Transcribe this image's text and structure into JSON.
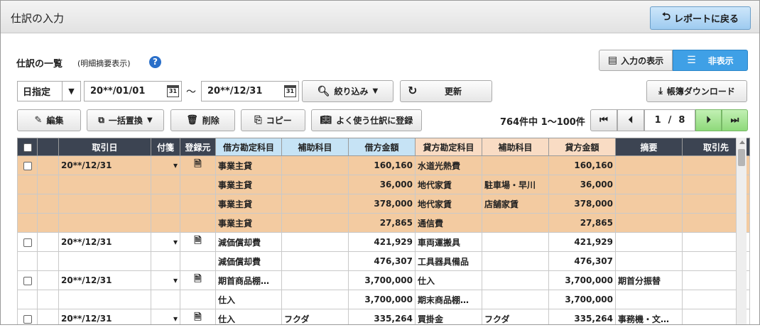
{
  "header": {
    "title": "仕訳の入力",
    "back_button": "レポートに戻る"
  },
  "list": {
    "title": "仕訳の一覧",
    "subtitle": "(明細摘要表示)",
    "help": "?"
  },
  "view_toggle": {
    "show": "入力の表示",
    "hide": "非表示"
  },
  "filters": {
    "period_type": "日指定",
    "date_from": "20**/01/01",
    "date_to": "20**/12/31",
    "tilde": "～",
    "calendar": "31",
    "narrow": "絞り込み",
    "refresh": "更新",
    "download": "帳簿ダウンロード"
  },
  "toolbar": {
    "edit": "編集",
    "bulk_replace": "一括置換",
    "delete": "削除",
    "copy": "コピー",
    "register_frequent": "よく使う仕訳に登録"
  },
  "pagination": {
    "info": "764件中 1～100件",
    "current": "1",
    "separator": "/",
    "total": "8"
  },
  "columns": [
    "取引日",
    "付箋",
    "登録元",
    "借方勘定科目",
    "補助科目",
    "借方金額",
    "貸方勘定科目",
    "補助科目",
    "貸方金額",
    "摘要",
    "取引先"
  ],
  "rows": [
    {
      "checkbox": true,
      "date": "20**/12/31",
      "tag": "▾",
      "src": true,
      "dr_acct": "事業主貸",
      "dr_sub": "",
      "dr_amt": "160,160",
      "cr_acct": "水道光熱費",
      "cr_sub": "",
      "cr_amt": "160,160",
      "memo": "",
      "partner": "",
      "hl": true
    },
    {
      "checkbox": false,
      "date": "",
      "tag": "",
      "src": false,
      "dr_acct": "事業主貸",
      "dr_sub": "",
      "dr_amt": "36,000",
      "cr_acct": "地代家賃",
      "cr_sub": "駐車場・早川",
      "cr_amt": "36,000",
      "memo": "",
      "partner": "",
      "hl": true
    },
    {
      "checkbox": false,
      "date": "",
      "tag": "",
      "src": false,
      "dr_acct": "事業主貸",
      "dr_sub": "",
      "dr_amt": "378,000",
      "cr_acct": "地代家賃",
      "cr_sub": "店舗家賃",
      "cr_amt": "378,000",
      "memo": "",
      "partner": "",
      "hl": true
    },
    {
      "checkbox": false,
      "date": "",
      "tag": "",
      "src": false,
      "dr_acct": "事業主貸",
      "dr_sub": "",
      "dr_amt": "27,865",
      "cr_acct": "通信費",
      "cr_sub": "",
      "cr_amt": "27,865",
      "memo": "",
      "partner": "",
      "hl": true
    },
    {
      "checkbox": true,
      "date": "20**/12/31",
      "tag": "▾",
      "src": true,
      "dr_acct": "減価償却費",
      "dr_sub": "",
      "dr_amt": "421,929",
      "cr_acct": "車両運搬具",
      "cr_sub": "",
      "cr_amt": "421,929",
      "memo": "",
      "partner": "",
      "hl": false
    },
    {
      "checkbox": false,
      "date": "",
      "tag": "",
      "src": false,
      "dr_acct": "減価償却費",
      "dr_sub": "",
      "dr_amt": "476,307",
      "cr_acct": "工具器具備品",
      "cr_sub": "",
      "cr_amt": "476,307",
      "memo": "",
      "partner": "",
      "hl": false
    },
    {
      "checkbox": true,
      "date": "20**/12/31",
      "tag": "▾",
      "src": true,
      "dr_acct": "期首商品棚…",
      "dr_sub": "",
      "dr_amt": "3,700,000",
      "cr_acct": "仕入",
      "cr_sub": "",
      "cr_amt": "3,700,000",
      "memo": "期首分振替",
      "partner": "",
      "hl": false
    },
    {
      "checkbox": false,
      "date": "",
      "tag": "",
      "src": false,
      "dr_acct": "仕入",
      "dr_sub": "",
      "dr_amt": "3,700,000",
      "cr_acct": "期末商品棚…",
      "cr_sub": "",
      "cr_amt": "3,700,000",
      "memo": "",
      "partner": "",
      "hl": false
    },
    {
      "checkbox": true,
      "date": "20**/12/31",
      "tag": "▾",
      "src": true,
      "dr_acct": "仕入",
      "dr_sub": "フクダ",
      "dr_amt": "335,264",
      "cr_acct": "買掛金",
      "cr_sub": "フクダ",
      "cr_amt": "335,264",
      "memo": "事務機・文…",
      "partner": "",
      "hl": false
    }
  ],
  "colors": {
    "header_dark": "#3c4452",
    "debit_header": "#c6e3f5",
    "credit_header": "#f9dcc4",
    "highlight_row": "#f3cba1",
    "accent_blue": "#3fa0e6",
    "page_green": "#9ee38c"
  }
}
